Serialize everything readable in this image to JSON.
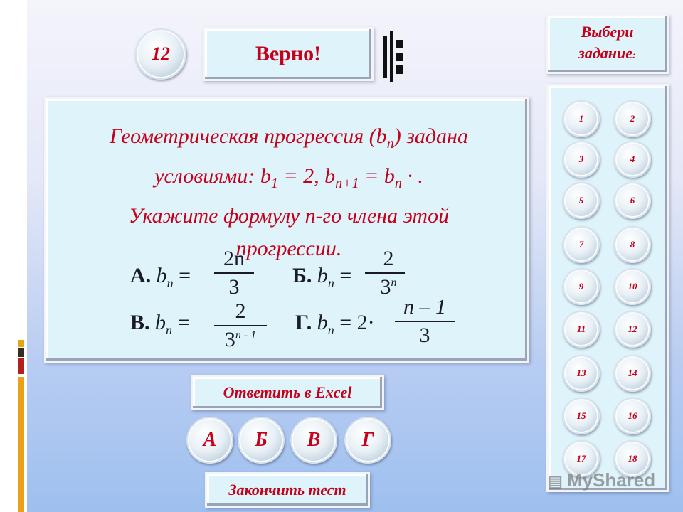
{
  "counter": "12",
  "status": "Верно!",
  "select_task": {
    "line1": "Выбери",
    "line2": "задание",
    "suffix": ":"
  },
  "question": {
    "line1": "Геометрическая прогрессия (b",
    "line1_sub": "n",
    "line1_end": ") задана",
    "line2_a": "условиями: b",
    "line2_sub1": "1",
    "line2_b": " = 2, b",
    "line2_sub2": "n+1",
    "line2_c": " = b",
    "line2_sub3": "n",
    "line2_d": " ·     .",
    "line3": "Укажите формулу n-го члена этой",
    "line4": "прогрессии."
  },
  "options": [
    {
      "letter": "А.",
      "lhs": " b",
      "sub": "n",
      "eq": " =",
      "num": "2n",
      "den": "3",
      "den_sup": ""
    },
    {
      "letter": "Б.",
      "lhs": " b",
      "sub": "n",
      "eq": " =",
      "num": "2",
      "den": "3",
      "den_sup": "n"
    },
    {
      "letter": "В.",
      "lhs": " b",
      "sub": "n",
      "eq": " =",
      "num": "2",
      "den": "3",
      "den_sup": "n - 1"
    },
    {
      "letter": "Г.",
      "lhs": " b",
      "sub": "n",
      "eq": " = 2·",
      "num": "n – 1",
      "den": "3",
      "den_sup": ""
    }
  ],
  "nav_items": [
    "1",
    "2",
    "3",
    "4",
    "5",
    "6",
    "7",
    "8",
    "9",
    "10",
    "11",
    "12",
    "13",
    "14",
    "15",
    "16",
    "17",
    "18"
  ],
  "excel_button": "Ответить в Excel",
  "answer_buttons": [
    "А",
    "Б",
    "В",
    "Г"
  ],
  "finish_button": "Закончить тест",
  "watermark": "MyShared",
  "colors": {
    "accent": "#c4001a",
    "panel": "#dff3fa",
    "strip_orange": "#e8a21a",
    "strip_dark": "#3a2b20",
    "strip_red": "#b02020"
  }
}
